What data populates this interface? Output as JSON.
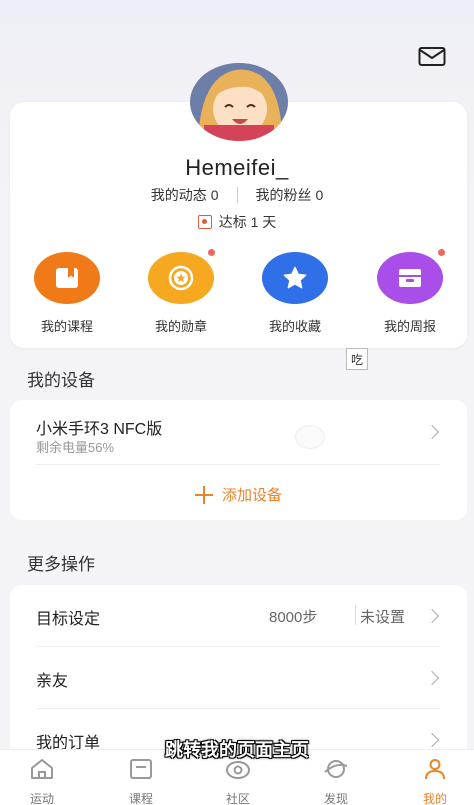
{
  "colors": {
    "accent": "#e8842a",
    "course": "#f07a17",
    "medal": "#f6a820",
    "favorite": "#2f6fe8",
    "weekly": "#a94ee8",
    "red_dot": "#f0665a"
  },
  "header": {
    "mail_icon": "mail-icon"
  },
  "profile": {
    "username": "Hemeifei_",
    "posts_label": "我的动态",
    "posts_count": "0",
    "fans_label": "我的粉丝",
    "fans_count": "0",
    "goal_label": "达标",
    "goal_value": "1 天"
  },
  "quick_actions": [
    {
      "label": "我的课程",
      "icon": "bookmark-icon",
      "badge": false
    },
    {
      "label": "我的勋章",
      "icon": "medal-icon",
      "badge": true
    },
    {
      "label": "我的收藏",
      "icon": "star-icon",
      "badge": false
    },
    {
      "label": "我的周报",
      "icon": "report-icon",
      "badge": true
    }
  ],
  "tooltip_char": "吃",
  "devices": {
    "title": "我的设备",
    "items": [
      {
        "name": "小米手环3 NFC版",
        "battery": "剩余电量56%"
      }
    ],
    "add_label": "添加设备"
  },
  "more_ops": {
    "title": "更多操作",
    "rows": [
      {
        "label": "目标设定",
        "value": "8000步",
        "extra": "未设置"
      },
      {
        "label": "亲友"
      },
      {
        "label": "我的订单"
      }
    ]
  },
  "subtitle": "跳转我的页面主页",
  "tabbar": {
    "items": [
      {
        "label": "运动",
        "icon": "home-icon",
        "active": false
      },
      {
        "label": "课程",
        "icon": "course-icon",
        "active": false
      },
      {
        "label": "社区",
        "icon": "community-icon",
        "active": false
      },
      {
        "label": "发现",
        "icon": "discover-icon",
        "active": false
      },
      {
        "label": "我的",
        "icon": "profile-icon",
        "active": true
      }
    ]
  }
}
